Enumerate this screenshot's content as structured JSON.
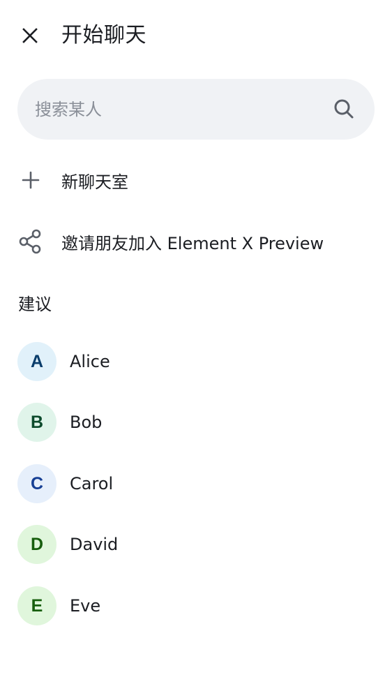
{
  "header": {
    "title": "开始聊天"
  },
  "search": {
    "placeholder": "搜索某人",
    "value": ""
  },
  "actions": [
    {
      "label": "新聊天室",
      "icon": "plus-icon"
    },
    {
      "label": "邀请朋友加入 Element X Preview",
      "icon": "share-icon"
    }
  ],
  "suggestions": {
    "title": "建议",
    "people": [
      {
        "initial": "A",
        "name": "Alice",
        "bg": "#e1f1fa",
        "fg": "#0a3d6b"
      },
      {
        "initial": "B",
        "name": "Bob",
        "bg": "#e0f4ea",
        "fg": "#0d4a2c"
      },
      {
        "initial": "C",
        "name": "Carol",
        "bg": "#e6effb",
        "fg": "#163f94"
      },
      {
        "initial": "D",
        "name": "David",
        "bg": "#e0f6dc",
        "fg": "#175e0e"
      },
      {
        "initial": "E",
        "name": "Eve",
        "bg": "#e0f6dc",
        "fg": "#175e0e"
      }
    ]
  },
  "colors": {
    "text_primary": "#1b1d22",
    "text_secondary": "#8a8f98",
    "icon": "#5a5f68",
    "search_bg": "#f0f2f5"
  }
}
